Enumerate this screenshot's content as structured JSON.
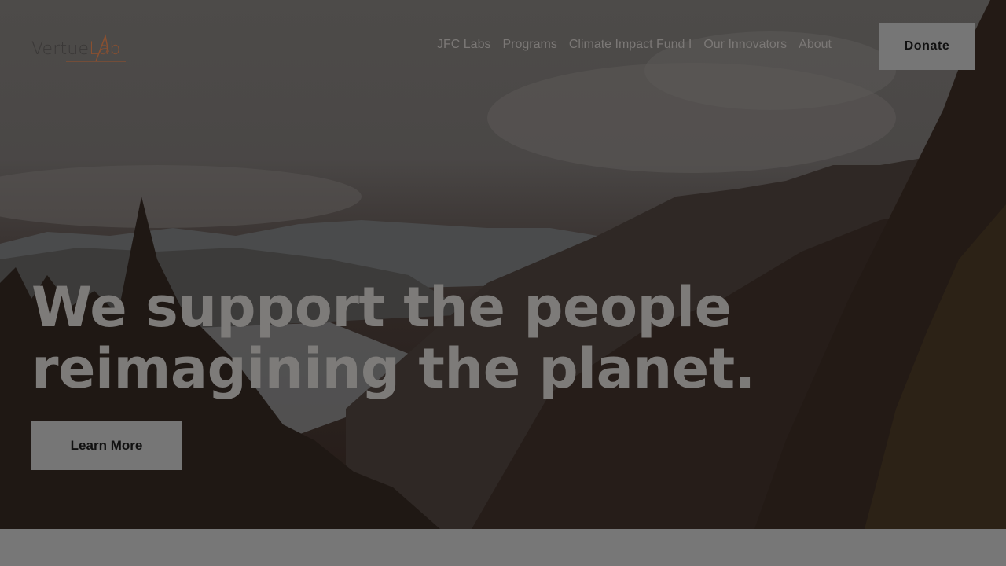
{
  "logo": {
    "text_main": "Vertue",
    "text_accent": "Lab"
  },
  "nav": {
    "items": [
      {
        "label": "JFC Labs"
      },
      {
        "label": "Programs"
      },
      {
        "label": "Climate Impact Fund I"
      },
      {
        "label": "Our Innovators"
      },
      {
        "label": "About"
      }
    ]
  },
  "header": {
    "donate_label": "Donate"
  },
  "hero": {
    "headline_line1": "We support the people",
    "headline_line2": "reimagining the planet.",
    "cta_label": "Learn More"
  },
  "colors": {
    "accent": "#8a5030",
    "button_bg": "#767676",
    "overlay_dark": "#241a16"
  }
}
